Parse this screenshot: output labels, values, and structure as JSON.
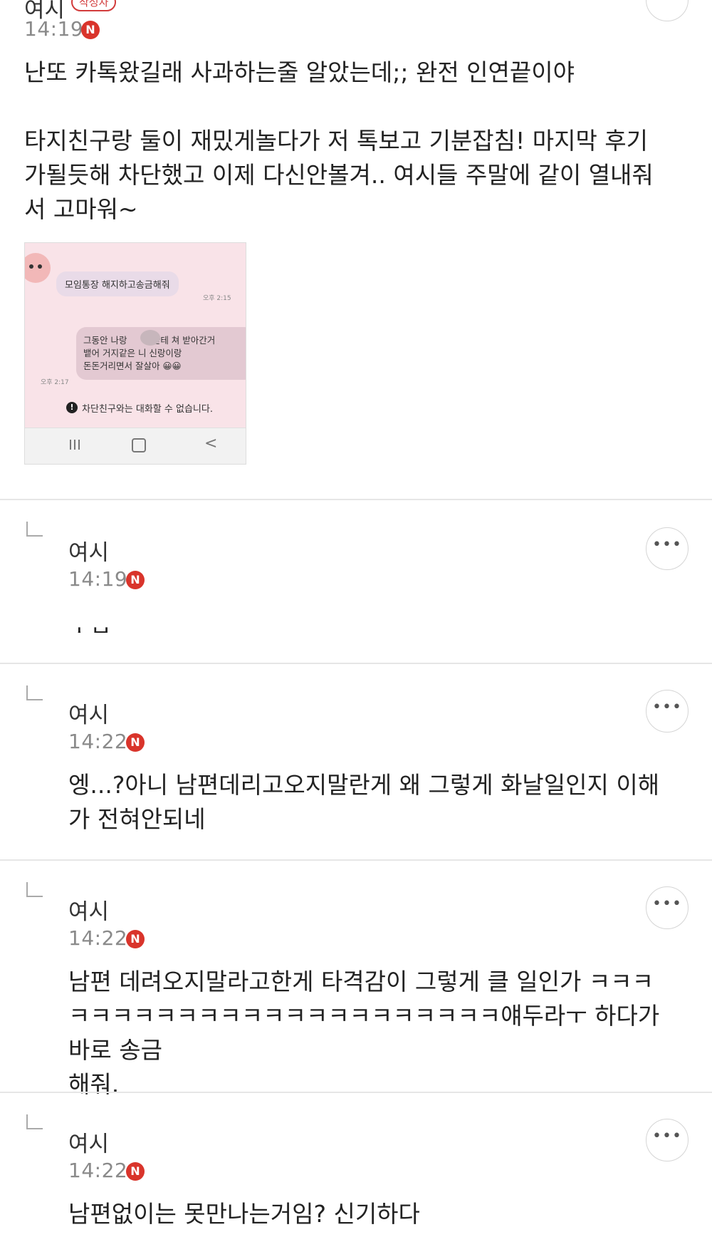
{
  "post": {
    "author": "여시",
    "author_badge": "작성자",
    "time": "14:19",
    "new_badge": "N",
    "more_label": "•••",
    "text": "난또 카톡왔길래 사과하는줄 알았는데;; 완전 인연끝이야\n\n타지친구랑 둘이 재밌게놀다가 저 톡보고 기분잡침! 마지막 후기\n가될듯해 차단했고 이제 다신안볼겨.. 여시들 주말에 같이 열내줘\n서 고마워~",
    "screenshot": {
      "bubble1": "모임통장 해지하고송금해줘",
      "time1": "오후 2:15",
      "bubble2": "그동안 나랑      이한테 쳐 받아간거\n뱉어 거지같은 니 신랑이랑\n돈돈거리면서 잘살아 😀😀",
      "time2": "오후 2:17",
      "notice": "차단친구와는 대화할 수 없습니다.",
      "notice_icon": "!",
      "nav_back": "<"
    }
  },
  "replies": [
    {
      "author": "여시",
      "time": "14:19",
      "new_badge": "N",
      "more_label": "•••",
      "text": "ㅅㅂ"
    },
    {
      "author": "여시",
      "time": "14:22",
      "new_badge": "N",
      "more_label": "•••",
      "text": "엥...?아니 남편데리고오지말란게 왜 그렇게 화날일인지 이해\n가 전혀안되네"
    },
    {
      "author": "여시",
      "time": "14:22",
      "new_badge": "N",
      "more_label": "•••",
      "text": "남편 데려오지말라고한게 타격감이 그렇게 클 일인가 ㅋㅋㅋ\nㅋㅋㅋㅋㅋㅋㅋㅋㅋㅋㅋㅋㅋㅋㅋㅋㅋㅋㅋㅋ얘두라ㅜ 하다가 바로 송금\n해줘."
    },
    {
      "author": "여시",
      "time": "14:22",
      "new_badge": "N",
      "more_label": "•••",
      "text": "남편없이는 못만나는거임? 신기하다"
    }
  ]
}
